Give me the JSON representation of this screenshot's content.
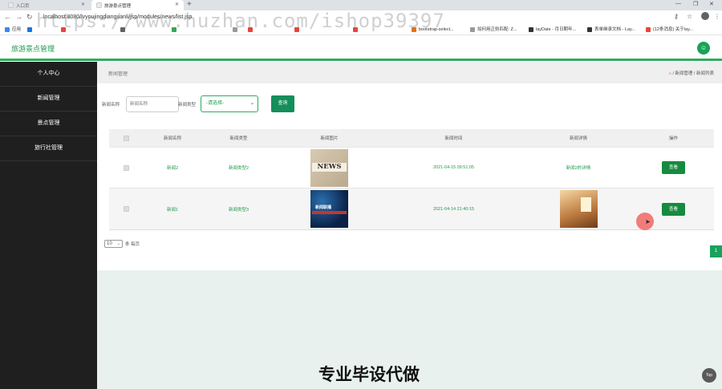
{
  "browser": {
    "tabs": [
      {
        "title": "入口页",
        "active": false
      },
      {
        "title": "旅游景点管理",
        "active": true
      }
    ],
    "new_tab": "+",
    "url": "localhost:8080/lvyoujingdianguanli/jsp/modules/news/list.jsp",
    "bookmarks": [
      {
        "label": "应用",
        "color": "#4285f4"
      },
      {
        "label": "",
        "color": "#1a73e8"
      },
      {
        "label": "",
        "color": "#e8453c"
      },
      {
        "label": "",
        "color": "#5f6368"
      },
      {
        "label": "",
        "color": "#34a853"
      },
      {
        "label": "",
        "color": "#999999"
      },
      {
        "label": "",
        "color": "#e8453c"
      },
      {
        "label": "",
        "color": "#e8453c"
      },
      {
        "label": "",
        "color": "#e8453c"
      },
      {
        "label": "bootstrap-select...",
        "color": "#e8710a"
      },
      {
        "label": "如何用正则匹配: Z...",
        "color": "#999999"
      },
      {
        "label": "layDate - 月日期年...",
        "color": "#333333"
      },
      {
        "label": "表单继承文档 - Lay...",
        "color": "#333333"
      },
      {
        "label": "(12条消息) 关于lay...",
        "color": "#e8453c"
      }
    ]
  },
  "app": {
    "title": "旅游景点管理",
    "accent": "#2eab5f"
  },
  "sidebar": {
    "items": [
      {
        "label": "个人中心"
      },
      {
        "label": "新闻管理"
      },
      {
        "label": "景点管理"
      },
      {
        "label": "旅行社管理"
      }
    ]
  },
  "breadcrumb": {
    "page_title": "新闻管理",
    "home_icon": "home-icon",
    "path": "/ 新闻管理 / 新闻列表"
  },
  "search": {
    "name_label": "新闻名称",
    "name_placeholder": "新闻名称",
    "type_label": "新闻类型",
    "type_value": "-请选择-",
    "button": "查询"
  },
  "table": {
    "columns": [
      "新闻名称",
      "新闻类型",
      "新闻图片",
      "新闻时间",
      "新闻详情",
      "操作"
    ],
    "rows": [
      {
        "name": "新闻2",
        "type": "新闻类型2",
        "image": "NEWS",
        "time": "2021-04-15 09:51:05",
        "detail": "新闻2的详情",
        "action": "查看"
      },
      {
        "name": "新闻1",
        "type": "新闻类型3",
        "image": "新闻联播",
        "time": "2021-04-14 21:40:15",
        "detail": "",
        "action": "查看"
      }
    ]
  },
  "pagination": {
    "page_size": "10",
    "page_size_suffix": "条 每页",
    "current_page": "1"
  },
  "overlay": {
    "watermark": "https://www.huzhan.com/ishop39397",
    "ad_text": "专业毕设代做",
    "back_top": "Top"
  }
}
